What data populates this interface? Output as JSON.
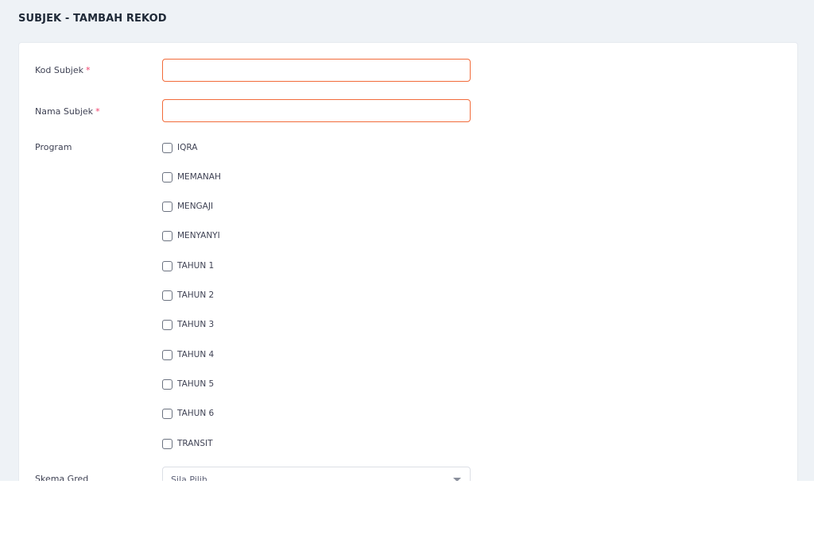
{
  "page": {
    "title": "SUBJEK - TAMBAH REKOD"
  },
  "form": {
    "kod_subjek": {
      "label": "Kod Subjek",
      "required_mark": "*",
      "value": "",
      "placeholder": ""
    },
    "nama_subjek": {
      "label": "Nama Subjek",
      "required_mark": "*",
      "value": "",
      "placeholder": ""
    },
    "program": {
      "label": "Program",
      "options": [
        {
          "label": "IQRA",
          "checked": false
        },
        {
          "label": "MEMANAH",
          "checked": false
        },
        {
          "label": "MENGAJI",
          "checked": false
        },
        {
          "label": "MENYANYI",
          "checked": false
        },
        {
          "label": "TAHUN 1",
          "checked": false
        },
        {
          "label": "TAHUN 2",
          "checked": false
        },
        {
          "label": "TAHUN 3",
          "checked": false
        },
        {
          "label": "TAHUN 4",
          "checked": false
        },
        {
          "label": "TAHUN 5",
          "checked": false
        },
        {
          "label": "TAHUN 6",
          "checked": false
        },
        {
          "label": "TRANSIT",
          "checked": false
        }
      ]
    },
    "skema_gred": {
      "label": "Skema Gred",
      "selected": "Sila Pilih"
    }
  },
  "colors": {
    "page_background": "#eef2f6",
    "required_mark": "#f1416c",
    "invalid_border": "#f26b3a"
  },
  "icons": {
    "select_caret": "chevron-down-icon"
  }
}
